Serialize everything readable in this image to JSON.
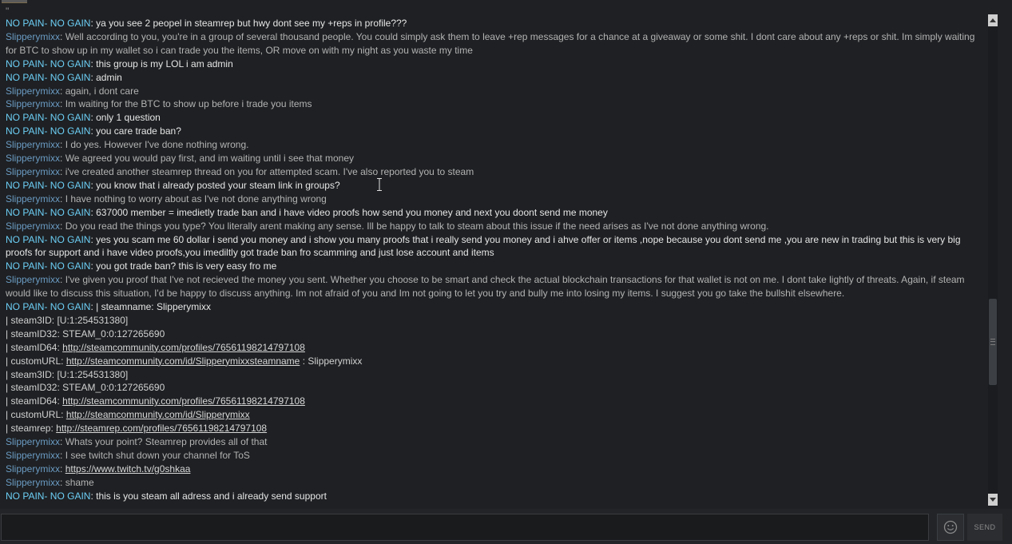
{
  "chat": {
    "messages": [
      {
        "kind": "stray",
        "text": "\""
      },
      {
        "kind": "msg",
        "who": "npng",
        "sender": "NO PAIN- NO GAIN",
        "text": "ya you see 2 peopel in steamrep but hwy dont see my +reps in profile???"
      },
      {
        "kind": "msg",
        "who": "slip",
        "sender": "Slipperymixx",
        "text": "Well according to you, you're in a group of several thousand people. You could simply ask them to leave +rep messages for a chance at a giveaway or some shit. I dont care about any +reps or shit. Im simply waiting for BTC to show up in my wallet so i can trade you the items, OR move on with my night as you waste my time"
      },
      {
        "kind": "msg",
        "who": "npng",
        "sender": "NO PAIN- NO GAIN",
        "text": "this group is my LOL i am admin"
      },
      {
        "kind": "msg",
        "who": "npng",
        "sender": "NO PAIN- NO GAIN",
        "text": "admin"
      },
      {
        "kind": "msg",
        "who": "slip",
        "sender": "Slipperymixx",
        "text": "again, i dont care"
      },
      {
        "kind": "msg",
        "who": "slip",
        "sender": "Slipperymixx",
        "text": "Im waiting for the BTC to show up before i trade you items"
      },
      {
        "kind": "msg",
        "who": "npng",
        "sender": "NO PAIN- NO GAIN",
        "text": "only 1 question"
      },
      {
        "kind": "msg",
        "who": "npng",
        "sender": "NO PAIN- NO GAIN",
        "text": "you care trade ban?"
      },
      {
        "kind": "msg",
        "who": "slip",
        "sender": "Slipperymixx",
        "text": "I do yes. However I've done nothing wrong."
      },
      {
        "kind": "msg",
        "who": "slip",
        "sender": "Slipperymixx",
        "text": "We agreed you would pay first, and im waiting until i see that money"
      },
      {
        "kind": "msg",
        "who": "slip",
        "sender": "Slipperymixx",
        "text": "i've created another steamrep thread on you for attempted scam. I've also reported you to steam"
      },
      {
        "kind": "msg",
        "who": "npng",
        "sender": "NO PAIN- NO GAIN",
        "text": "you know that i already posted your steam link in groups?"
      },
      {
        "kind": "msg",
        "who": "slip",
        "sender": "Slipperymixx",
        "text": "I have nothing to worry about as I've not done anything wrong"
      },
      {
        "kind": "msg",
        "who": "npng",
        "sender": "NO PAIN- NO GAIN",
        "text": "637000 member = imedietly trade ban and i have video proofs how send you money and next you doont send me money"
      },
      {
        "kind": "msg",
        "who": "slip",
        "sender": "Slipperymixx",
        "text": "Do you read the things you type? You literally arent making any sense. Ill be happy to talk to steam about this issue if the need arises as I've not done anything wrong."
      },
      {
        "kind": "msg",
        "who": "npng",
        "sender": "NO PAIN- NO GAIN",
        "text": "yes you scam me 60 dollar i send  you money and i show you many proofs that i really send you money and i ahve offer or items ,nope because you dont send me ,you are new in trading but this is very big proofs for support and i have video proofs,you imediltly got trade ban fro scamming and just lose account and items"
      },
      {
        "kind": "msg",
        "who": "npng",
        "sender": "NO PAIN- NO GAIN",
        "text": "you got trade ban? this is very easy fro me"
      },
      {
        "kind": "msg",
        "who": "slip",
        "sender": "Slipperymixx",
        "text": "I've given you proof that I've not recieved the money you sent. Whether you choose to be smart and check the actual blockchain transactions for that wallet is not on me. I dont take lightly of threats. Again, if steam would like to discuss this situation, I'd be happy to discuss anything. Im not afraid of you and Im not going to let you try and bully me into losing my items. I suggest you go take the bullshit elsewhere."
      },
      {
        "kind": "msg",
        "who": "npng",
        "sender": "NO PAIN- NO GAIN",
        "text": "| steamname: Slipperymixx"
      },
      {
        "kind": "plain",
        "text": "|  steam3ID: [U:1:254531380]"
      },
      {
        "kind": "plain",
        "text": "| steamID32: STEAM_0:0:127265690"
      },
      {
        "kind": "link",
        "prefix": "| steamID64: ",
        "link": "http://steamcommunity.com/profiles/76561198214797108",
        "suffix": ""
      },
      {
        "kind": "link",
        "prefix": "| customURL: ",
        "link": "http://steamcommunity.com/id/Slipperymixxsteamname",
        "suffix": " : Slipperymixx"
      },
      {
        "kind": "plain",
        "text": "|  steam3ID: [U:1:254531380]"
      },
      {
        "kind": "plain",
        "text": "| steamID32: STEAM_0:0:127265690"
      },
      {
        "kind": "link",
        "prefix": "| steamID64: ",
        "link": "http://steamcommunity.com/profiles/76561198214797108",
        "suffix": ""
      },
      {
        "kind": "link",
        "prefix": "| customURL: ",
        "link": "http://steamcommunity.com/id/Slipperymixx",
        "suffix": ""
      },
      {
        "kind": "link",
        "prefix": "|  steamrep: ",
        "link": "http://steamrep.com/profiles/76561198214797108",
        "suffix": ""
      },
      {
        "kind": "msg",
        "who": "slip",
        "sender": "Slipperymixx",
        "text": "Whats your point? Steamrep provides all of that"
      },
      {
        "kind": "msg",
        "who": "slip",
        "sender": "Slipperymixx",
        "text": "I see twitch shut down your channel for ToS"
      },
      {
        "kind": "msglink",
        "who": "slip",
        "sender": "Slipperymixx",
        "link": "https://www.twitch.tv/g0shkaa"
      },
      {
        "kind": "msg",
        "who": "slip",
        "sender": "Slipperymixx",
        "text": "shame"
      },
      {
        "kind": "msg",
        "who": "npng",
        "sender": "NO PAIN- NO GAIN",
        "text": "this is you steam all adress and i already send support"
      }
    ]
  },
  "composer": {
    "input_value": "",
    "send_label": "SEND",
    "emoticon_icon": "smiley-icon"
  },
  "colors": {
    "npng_name": "#6dcff6",
    "slip_name": "#6b9bc3",
    "background": "#1e2023"
  }
}
